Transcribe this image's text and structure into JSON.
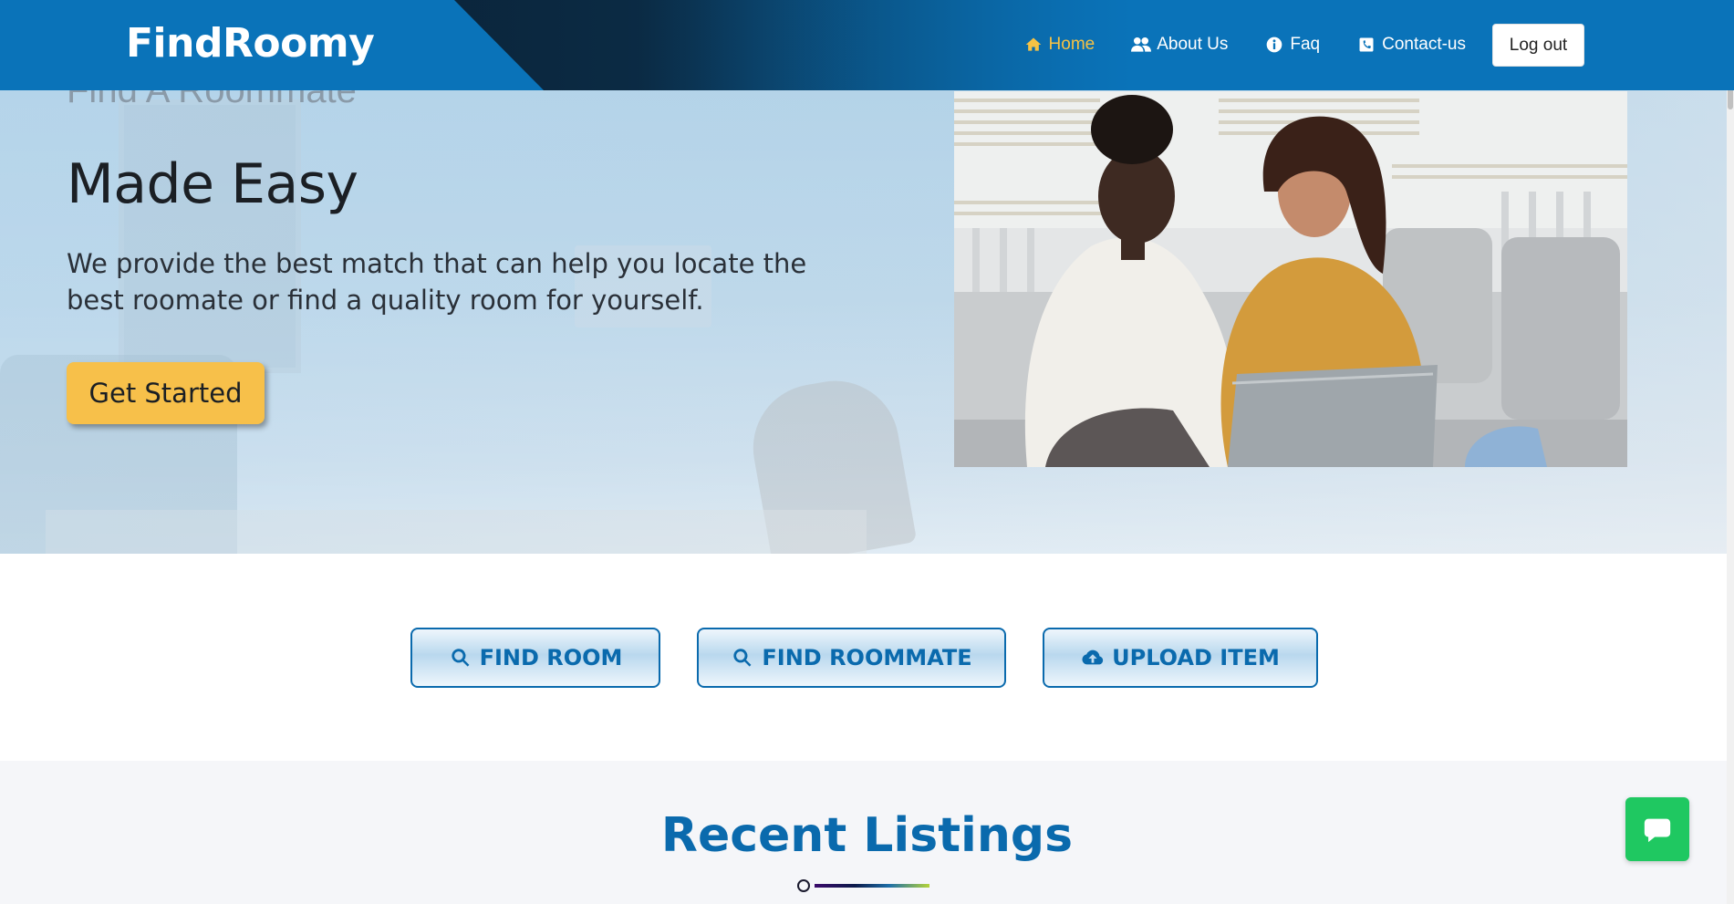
{
  "brand": {
    "name": "FindRoomy"
  },
  "nav": {
    "links": [
      {
        "label": "Home",
        "icon": "home-icon",
        "active": true
      },
      {
        "label": "About Us",
        "icon": "users-icon",
        "active": false
      },
      {
        "label": "Faq",
        "icon": "info-icon",
        "active": false
      },
      {
        "label": "Contact-us",
        "icon": "contact-icon",
        "active": false
      }
    ],
    "logout_label": "Log out"
  },
  "hero": {
    "kicker": "Find A Roommate",
    "title": "Made Easy",
    "description": "We provide the best match that can help you locate the best roomate or find a quality room for yourself.",
    "cta_label": "Get Started"
  },
  "actions": [
    {
      "label": "FIND ROOM",
      "icon": "search-icon"
    },
    {
      "label": "FIND ROOMMATE",
      "icon": "search-icon"
    },
    {
      "label": "UPLOAD ITEM",
      "icon": "cloud-upload-icon"
    }
  ],
  "recent": {
    "title": "Recent Listings"
  },
  "colors": {
    "primary": "#0a73b9",
    "accent": "#f7c04a",
    "active_nav": "#f6c244",
    "chat": "#1fc861"
  },
  "chat": {
    "icon": "chat-icon"
  }
}
